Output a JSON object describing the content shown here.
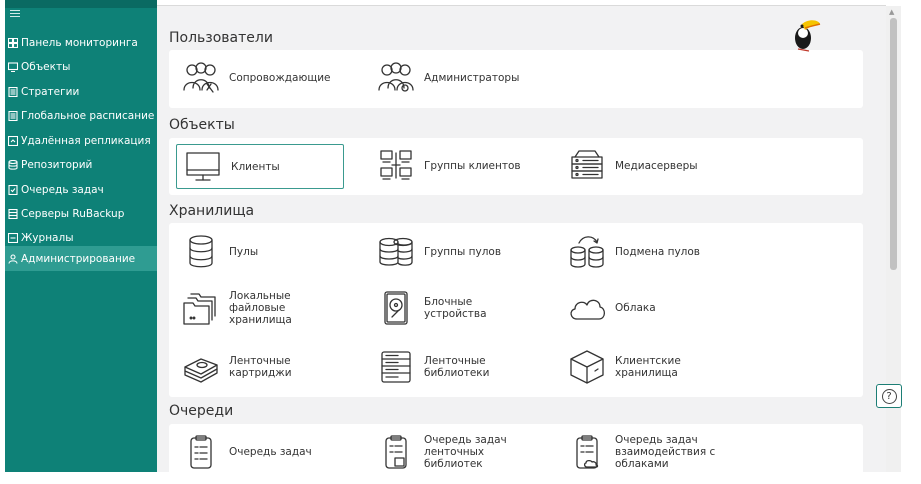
{
  "sidebar": {
    "items": [
      {
        "label": "Панель мониторинга",
        "icon": "dashboard-icon"
      },
      {
        "label": "Объекты",
        "icon": "monitor-icon"
      },
      {
        "label": "Стратегии",
        "icon": "document-icon"
      },
      {
        "label": "Глобальное расписание",
        "icon": "schedule-icon"
      },
      {
        "label": "Удалённая репликация",
        "icon": "replication-icon"
      },
      {
        "label": "Репозиторий",
        "icon": "database-icon"
      },
      {
        "label": "Очередь задач",
        "icon": "checklist-icon"
      },
      {
        "label": "Серверы RuBackup",
        "icon": "server-icon"
      },
      {
        "label": "Журналы",
        "icon": "log-icon"
      },
      {
        "label": "Администрирование",
        "icon": "users-icon",
        "active": true
      }
    ]
  },
  "sections": {
    "users": {
      "title": "Пользователи",
      "tiles": [
        {
          "label": "Сопровождающие",
          "icon": "maintainers-icon"
        },
        {
          "label": "Администраторы",
          "icon": "administrators-icon"
        }
      ]
    },
    "objects": {
      "title": "Объекты",
      "tiles": [
        {
          "label": "Клиенты",
          "icon": "client-monitor-icon",
          "selected": true
        },
        {
          "label": "Группы клиентов",
          "icon": "client-groups-icon"
        },
        {
          "label": "Медиасерверы",
          "icon": "media-server-icon"
        }
      ]
    },
    "storages": {
      "title": "Хранилища",
      "tiles": [
        {
          "label": "Пулы",
          "icon": "pool-icon"
        },
        {
          "label": "Группы пулов",
          "icon": "pool-groups-icon"
        },
        {
          "label": "Подмена пулов",
          "icon": "pool-swap-icon"
        },
        {
          "label": "Локальные\nфайловые\nхранилища",
          "icon": "local-folders-icon"
        },
        {
          "label": "Блочные\nустройства",
          "icon": "block-device-icon"
        },
        {
          "label": "Облака",
          "icon": "cloud-icon"
        },
        {
          "label": "Ленточные\nкартриджи",
          "icon": "tape-cartridge-icon"
        },
        {
          "label": "Ленточные\nбиблиотеки",
          "icon": "tape-library-icon"
        },
        {
          "label": "Клиентские\nхранилища",
          "icon": "client-storage-box-icon"
        }
      ]
    },
    "queues": {
      "title": "Очереди",
      "tiles": [
        {
          "label": "Очередь задач",
          "icon": "task-queue-icon"
        },
        {
          "label": "Очередь задач\nленточных\nбиблиотек",
          "icon": "tape-task-queue-icon"
        },
        {
          "label": "Очередь задач\nвзаимодействия с\nоблаками",
          "icon": "cloud-task-queue-icon"
        }
      ]
    }
  },
  "help": {
    "label": "?"
  },
  "colors": {
    "sidebar": "#0e8177",
    "sidebar_active": "#2f9c92",
    "main_bg": "#f2f2f3",
    "accent_border": "#3a9a8f"
  }
}
